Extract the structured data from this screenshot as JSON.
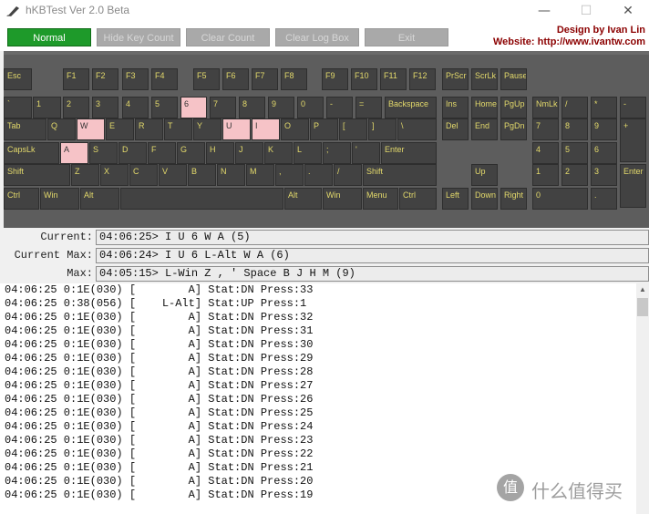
{
  "window": {
    "title": "hKBTest Ver 2.0 Beta",
    "minimize": "—",
    "maximize": "☐",
    "close": "✕"
  },
  "toolbar": {
    "buttons": [
      {
        "label": "Normal",
        "state": "active"
      },
      {
        "label": "Hide Key Count",
        "state": "disabled"
      },
      {
        "label": "Clear Count",
        "state": "disabled"
      },
      {
        "label": "Clear Log Box",
        "state": "disabled"
      },
      {
        "label": "Exit",
        "state": "disabled"
      }
    ],
    "credit1": "Design by Ivan Lin",
    "credit2": "Website: http://www.ivantw.com"
  },
  "keyboard": {
    "pressed_color": "#f6c3c7",
    "keys": [
      {
        "label": "Esc"
      },
      {
        "label": "F1"
      },
      {
        "label": "F2"
      },
      {
        "label": "F3"
      },
      {
        "label": "F4"
      },
      {
        "label": "F5"
      },
      {
        "label": "F6"
      },
      {
        "label": "F7"
      },
      {
        "label": "F8"
      },
      {
        "label": "F9"
      },
      {
        "label": "F10"
      },
      {
        "label": "F11"
      },
      {
        "label": "F12"
      },
      {
        "label": "PrScr"
      },
      {
        "label": "ScrLk"
      },
      {
        "label": "Pause"
      },
      {
        "label": "`"
      },
      {
        "label": "1"
      },
      {
        "label": "2"
      },
      {
        "label": "3"
      },
      {
        "label": "4"
      },
      {
        "label": "5"
      },
      {
        "label": "6",
        "pressed": true
      },
      {
        "label": "7"
      },
      {
        "label": "8"
      },
      {
        "label": "9"
      },
      {
        "label": "0"
      },
      {
        "label": "-"
      },
      {
        "label": "="
      },
      {
        "label": "Backspace"
      },
      {
        "label": "Ins"
      },
      {
        "label": "Home"
      },
      {
        "label": "PgUp"
      },
      {
        "label": "NmLk"
      },
      {
        "label": "/"
      },
      {
        "label": "*"
      },
      {
        "label": "-"
      },
      {
        "label": "Tab"
      },
      {
        "label": "Q"
      },
      {
        "label": "W",
        "pressed": true
      },
      {
        "label": "E"
      },
      {
        "label": "R"
      },
      {
        "label": "T"
      },
      {
        "label": "Y"
      },
      {
        "label": "U",
        "pressed": true
      },
      {
        "label": "I",
        "pressed": true
      },
      {
        "label": "O"
      },
      {
        "label": "P"
      },
      {
        "label": "["
      },
      {
        "label": "]"
      },
      {
        "label": "\\"
      },
      {
        "label": "Del"
      },
      {
        "label": "End"
      },
      {
        "label": "PgDn"
      },
      {
        "label": "7"
      },
      {
        "label": "8"
      },
      {
        "label": "9"
      },
      {
        "label": "+"
      },
      {
        "label": "CapsLk"
      },
      {
        "label": "A",
        "pressed": true
      },
      {
        "label": "S"
      },
      {
        "label": "D"
      },
      {
        "label": "F"
      },
      {
        "label": "G"
      },
      {
        "label": "H"
      },
      {
        "label": "J"
      },
      {
        "label": "K"
      },
      {
        "label": "L"
      },
      {
        "label": ";"
      },
      {
        "label": "'"
      },
      {
        "label": "Enter"
      },
      {
        "label": "4"
      },
      {
        "label": "5"
      },
      {
        "label": "6"
      },
      {
        "label": "Shift"
      },
      {
        "label": "Z"
      },
      {
        "label": "X"
      },
      {
        "label": "C"
      },
      {
        "label": "V"
      },
      {
        "label": "B"
      },
      {
        "label": "N"
      },
      {
        "label": "M"
      },
      {
        "label": ","
      },
      {
        "label": "."
      },
      {
        "label": "/"
      },
      {
        "label": "Shift"
      },
      {
        "label": "Up"
      },
      {
        "label": "1"
      },
      {
        "label": "2"
      },
      {
        "label": "3"
      },
      {
        "label": "Enter"
      },
      {
        "label": "Ctrl"
      },
      {
        "label": "Win"
      },
      {
        "label": "Alt"
      },
      {
        "label": ""
      },
      {
        "label": "Alt"
      },
      {
        "label": "Win"
      },
      {
        "label": "Menu"
      },
      {
        "label": "Ctrl"
      },
      {
        "label": "Left"
      },
      {
        "label": "Down"
      },
      {
        "label": "Right"
      },
      {
        "label": "0"
      },
      {
        "label": "."
      }
    ]
  },
  "status": {
    "current_label": "Current:",
    "current_value": "04:06:25> I U 6 W A (5)",
    "current_max_label": "Current Max:",
    "current_max_value": "04:06:24> I U 6 L-Alt W A (6)",
    "max_label": "Max:",
    "max_value": "04:05:15> L-Win Z , ' Space B J H M (9)"
  },
  "log": [
    "04:06:25 0:1E(030) [        A] Stat:DN Press:33",
    "04:06:25 0:38(056) [    L-Alt] Stat:UP Press:1",
    "04:06:25 0:1E(030) [        A] Stat:DN Press:32",
    "04:06:25 0:1E(030) [        A] Stat:DN Press:31",
    "04:06:25 0:1E(030) [        A] Stat:DN Press:30",
    "04:06:25 0:1E(030) [        A] Stat:DN Press:29",
    "04:06:25 0:1E(030) [        A] Stat:DN Press:28",
    "04:06:25 0:1E(030) [        A] Stat:DN Press:27",
    "04:06:25 0:1E(030) [        A] Stat:DN Press:26",
    "04:06:25 0:1E(030) [        A] Stat:DN Press:25",
    "04:06:25 0:1E(030) [        A] Stat:DN Press:24",
    "04:06:25 0:1E(030) [        A] Stat:DN Press:23",
    "04:06:25 0:1E(030) [        A] Stat:DN Press:22",
    "04:06:25 0:1E(030) [        A] Stat:DN Press:21",
    "04:06:25 0:1E(030) [        A] Stat:DN Press:20",
    "04:06:25 0:1E(030) [        A] Stat:DN Press:19"
  ],
  "watermark": {
    "badge": "值",
    "text": "什么值得买"
  }
}
